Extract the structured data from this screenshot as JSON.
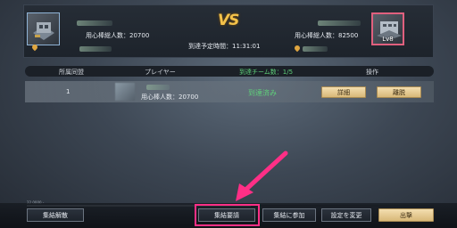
{
  "vs_label": "VS",
  "self_side": {
    "troops_text": "用心棒総人数：20700"
  },
  "enemy_side": {
    "troops_text": "用心棒総人数：82500",
    "level_label": "Lv8"
  },
  "arrival_text": "到達予定時間：11:31:01",
  "table": {
    "headers": [
      "所属同盟",
      "プレイヤー",
      "到達チーム数：1/5",
      "操作"
    ],
    "rows": [
      {
        "rank": "1",
        "troops_text": "用心棒人数：20700",
        "status": "到達済み",
        "detail_button": "詳細",
        "leave_button": "離脱"
      }
    ]
  },
  "progress": {
    "text": "22 0000 -",
    "fraction": 0.55
  },
  "bottom": {
    "disband_button": "集結解散",
    "request_button": "集結要請",
    "join_button": "集結に参加",
    "settings_button": "設定を変更",
    "attack_button": "出撃"
  },
  "colors": {
    "vs": "#f4c24a",
    "status_arrived": "#5fd07a",
    "team_count": "#5fd07a",
    "highlight": "#ff2f86",
    "enemy_frame": "#e0607e"
  },
  "icons": {
    "location_pin": "map-pin-icon",
    "pointer": "arrow-pointer-icon"
  }
}
